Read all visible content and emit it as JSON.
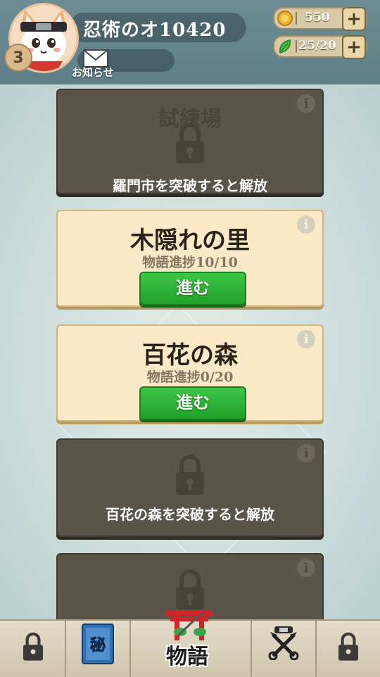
{
  "header": {
    "player_name": "忍術のオ10420",
    "level": "3",
    "mail_label": "お知らせ",
    "coins": "550",
    "energy": "25/20"
  },
  "cards": [
    {
      "title": "試練場",
      "locked": true,
      "unlock_text": "羅門市を突破すると解放"
    },
    {
      "title": "木隠れの里",
      "locked": false,
      "progress": "物語進捗10/10",
      "button": "進む"
    },
    {
      "title": "百花の森",
      "locked": false,
      "progress": "物語進捗0/20",
      "button": "進む"
    },
    {
      "locked": true,
      "unlock_text": "百花の森を突破すると解放"
    },
    {
      "locked": true
    }
  ],
  "bottom_nav": {
    "items": [
      {
        "icon": "lock-icon",
        "locked": true
      },
      {
        "icon": "secret-scroll-icon",
        "glyph": "秘"
      },
      {
        "icon": "story-torii-icon",
        "label": "物語",
        "active": true
      },
      {
        "icon": "crossed-kunai-icon"
      },
      {
        "icon": "lock-icon",
        "locked": true
      }
    ]
  },
  "colors": {
    "go_button": "#22a12b",
    "locked_card": "#5a5449",
    "open_card": "#fbe9c8"
  }
}
